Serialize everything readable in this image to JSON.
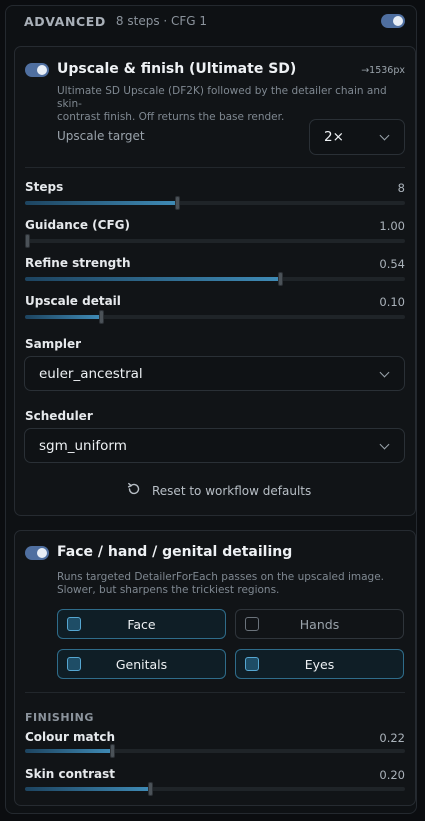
{
  "advanced": {
    "title": "ADVANCED",
    "meta": "8 steps · CFG 1",
    "toggle_on": true
  },
  "upscale": {
    "title": "Upscale & finish (Ultimate SD)",
    "enabled": true,
    "px_label": "→1536px",
    "description_line1": "Ultimate SD Upscale (DF2K) followed by the detailer chain and skin-",
    "description_line2": "contrast finish. Off returns the base render.",
    "target_label": "Upscale target",
    "target_value": "2×"
  },
  "sliders": [
    {
      "label": "Steps",
      "value": "8",
      "level": 0.4
    },
    {
      "label": "Guidance (CFG)",
      "value": "1.00",
      "level": 0.0
    },
    {
      "label": "Refine strength",
      "value": "0.54",
      "level": 0.67
    },
    {
      "label": "Upscale detail",
      "value": "0.10",
      "level": 0.2
    }
  ],
  "sampler": {
    "label": "Sampler",
    "value": "euler_ancestral"
  },
  "scheduler": {
    "label": "Scheduler",
    "value": "sgm_uniform"
  },
  "reset_label": "Reset to workflow defaults",
  "detailing": {
    "title": "Face / hand / genital detailing",
    "enabled": true,
    "description_line1": "Runs targeted DetailerForEach passes on the upscaled image.",
    "description_line2": "Slower, but sharpens the trickiest regions.",
    "options": [
      {
        "label": "Face",
        "checked": true
      },
      {
        "label": "Hands",
        "checked": false
      },
      {
        "label": "Genitals",
        "checked": true
      },
      {
        "label": "Eyes",
        "checked": true
      }
    ]
  },
  "finishing": {
    "title": "FINISHING",
    "sliders": [
      {
        "label": "Colour match",
        "value": "0.22",
        "level": 0.23
      },
      {
        "label": "Skin contrast",
        "value": "0.20",
        "level": 0.33
      }
    ]
  },
  "colors": {
    "accent": "#3f8bb6",
    "toggle": "#4f6fa0"
  }
}
